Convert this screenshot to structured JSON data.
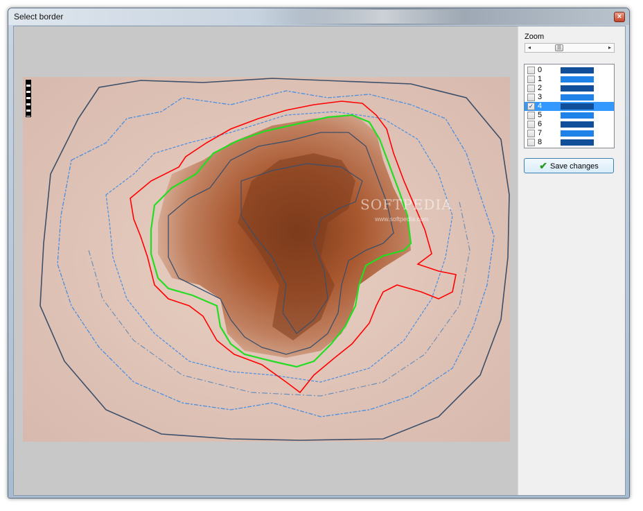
{
  "window": {
    "title": "Select border",
    "close_glyph": "×"
  },
  "watermark": {
    "brand": "SOFTPEDIA",
    "url": "www.softpedia.com"
  },
  "zoom": {
    "label": "Zoom",
    "value_fraction": 0.33,
    "left_arrow": "◂",
    "right_arrow": "▸",
    "thumb_glyph": "|||"
  },
  "borders": {
    "items": [
      {
        "label": "0",
        "checked": false,
        "selected": false,
        "color": "#124f9a"
      },
      {
        "label": "1",
        "checked": false,
        "selected": false,
        "color": "#1e82e8"
      },
      {
        "label": "2",
        "checked": false,
        "selected": false,
        "color": "#124f9a"
      },
      {
        "label": "3",
        "checked": false,
        "selected": false,
        "color": "#1e82e8"
      },
      {
        "label": "4",
        "checked": true,
        "selected": true,
        "color": "#124f9a"
      },
      {
        "label": "5",
        "checked": false,
        "selected": false,
        "color": "#1e82e8"
      },
      {
        "label": "6",
        "checked": false,
        "selected": false,
        "color": "#124f9a"
      },
      {
        "label": "7",
        "checked": false,
        "selected": false,
        "color": "#1e82e8"
      },
      {
        "label": "8",
        "checked": false,
        "selected": false,
        "color": "#124f9a"
      }
    ]
  },
  "save_button": {
    "label": "Save changes",
    "icon": "check-icon"
  },
  "colors": {
    "red_border": "#ff0000",
    "green_border": "#22dd22",
    "dark_border": "#3b4f6a",
    "blue_border": "#4a8ee0"
  }
}
